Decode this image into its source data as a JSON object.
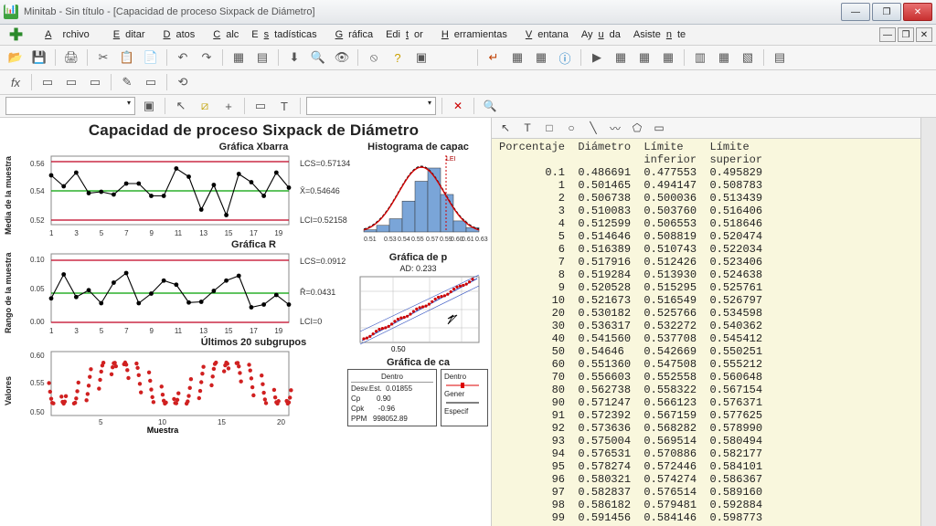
{
  "window": {
    "title": "Minitab - Sin título - [Capacidad de proceso Sixpack de Diámetro]"
  },
  "menu": [
    "Archivo",
    "Editar",
    "Datos",
    "Calc",
    "Estadísticas",
    "Gráfica",
    "Editor",
    "Herramientas",
    "Ventana",
    "Ayuda",
    "Asistente"
  ],
  "main": {
    "title": "Capacidad de proceso Sixpack de Diámetro",
    "xbar_title": "Gráfica Xbarra",
    "xbar_ylabel": "Media de la muestra",
    "xbar_lcs": "LCS=0.57134",
    "xbar_mean": "X̄=0.54646",
    "xbar_lci": "LCI=0.52158",
    "r_title": "Gráfica R",
    "r_ylabel": "Rango de la muestra",
    "r_lcs": "LCS=0.0912",
    "r_mean": "R̄=0.0431",
    "r_lci": "LCI=0",
    "sub_title": "Últimos 20 subgrupos",
    "sub_ylabel": "Valores",
    "sub_xlabel": "Muestra",
    "hist_title": "Histograma de capac",
    "prob_title": "Gráfica de p",
    "prob_ad": "AD: 0.233",
    "cap_title": "Gráfica de ca",
    "legend": {
      "head": "Dentro",
      "desv": "Desv.Est.",
      "desv_v": "0.01855",
      "cp": "Cp",
      "cp_v": "0.90",
      "cpk": "Cpk",
      "cpk_v": "-0.96",
      "ppm": "PPM",
      "ppm_v": "998052.89",
      "gen": "Gener",
      "esp": "Especif"
    }
  },
  "chart_data": [
    {
      "type": "line",
      "name": "xbar",
      "x": [
        1,
        3,
        5,
        7,
        9,
        11,
        13,
        15,
        17,
        19
      ],
      "values": [
        0.556,
        0.548,
        0.558,
        0.543,
        0.544,
        0.542,
        0.55,
        0.55,
        0.541,
        0.541,
        0.561,
        0.555,
        0.531,
        0.549,
        0.527,
        0.557,
        0.551,
        0.541,
        0.558,
        0.547
      ],
      "center": 0.54646,
      "ucl": 0.57134,
      "lcl": 0.52158,
      "ylim": [
        0.52,
        0.57
      ]
    },
    {
      "type": "line",
      "name": "r",
      "x": [
        1,
        3,
        5,
        7,
        9,
        11,
        13,
        15,
        17,
        19
      ],
      "values": [
        0.035,
        0.07,
        0.037,
        0.047,
        0.028,
        0.058,
        0.072,
        0.028,
        0.042,
        0.061,
        0.055,
        0.029,
        0.03,
        0.046,
        0.061,
        0.068,
        0.022,
        0.026,
        0.04,
        0.026
      ],
      "center": 0.0431,
      "ucl": 0.0912,
      "lcl": 0,
      "ylim": [
        0.0,
        0.1
      ]
    },
    {
      "type": "scatter",
      "name": "last20",
      "xlabel": "Muestra",
      "x": [
        1,
        2,
        3,
        4,
        5,
        6,
        7,
        8,
        9,
        10,
        11,
        12,
        13,
        14,
        15,
        16,
        17,
        18,
        19,
        20
      ],
      "ylim": [
        0.5,
        0.6
      ]
    },
    {
      "type": "bar",
      "name": "histogram",
      "categories": [
        0.51,
        0.53,
        0.54,
        0.55,
        0.57,
        0.59,
        0.6,
        0.61,
        0.63
      ],
      "values": [
        1,
        3,
        6,
        14,
        23,
        29,
        17,
        5,
        2
      ]
    },
    {
      "type": "line",
      "name": "probability",
      "xticks": [
        0.5
      ]
    }
  ],
  "table": {
    "headers": [
      "Porcentaje",
      "Diámetro",
      "Límite inferior",
      "Límite superior"
    ],
    "rows": [
      [
        "0.1",
        "0.486691",
        "0.477553",
        "0.495829"
      ],
      [
        "1",
        "0.501465",
        "0.494147",
        "0.508783"
      ],
      [
        "2",
        "0.506738",
        "0.500036",
        "0.513439"
      ],
      [
        "3",
        "0.510083",
        "0.503760",
        "0.516406"
      ],
      [
        "4",
        "0.512599",
        "0.506553",
        "0.518646"
      ],
      [
        "5",
        "0.514646",
        "0.508819",
        "0.520474"
      ],
      [
        "6",
        "0.516389",
        "0.510743",
        "0.522034"
      ],
      [
        "7",
        "0.517916",
        "0.512426",
        "0.523406"
      ],
      [
        "8",
        "0.519284",
        "0.513930",
        "0.524638"
      ],
      [
        "9",
        "0.520528",
        "0.515295",
        "0.525761"
      ],
      [
        "10",
        "0.521673",
        "0.516549",
        "0.526797"
      ],
      [
        "20",
        "0.530182",
        "0.525766",
        "0.534598"
      ],
      [
        "30",
        "0.536317",
        "0.532272",
        "0.540362"
      ],
      [
        "40",
        "0.541560",
        "0.537708",
        "0.545412"
      ],
      [
        "50",
        "0.54646",
        "0.542669",
        "0.550251"
      ],
      [
        "60",
        "0.551360",
        "0.547508",
        "0.555212"
      ],
      [
        "70",
        "0.556603",
        "0.552558",
        "0.560648"
      ],
      [
        "80",
        "0.562738",
        "0.558322",
        "0.567154"
      ],
      [
        "90",
        "0.571247",
        "0.566123",
        "0.576371"
      ],
      [
        "91",
        "0.572392",
        "0.567159",
        "0.577625"
      ],
      [
        "92",
        "0.573636",
        "0.568282",
        "0.578990"
      ],
      [
        "93",
        "0.575004",
        "0.569514",
        "0.580494"
      ],
      [
        "94",
        "0.576531",
        "0.570886",
        "0.582177"
      ],
      [
        "95",
        "0.578274",
        "0.572446",
        "0.584101"
      ],
      [
        "96",
        "0.580321",
        "0.574274",
        "0.586367"
      ],
      [
        "97",
        "0.582837",
        "0.576514",
        "0.589160"
      ],
      [
        "98",
        "0.586182",
        "0.579481",
        "0.592884"
      ],
      [
        "99",
        "0.591456",
        "0.584146",
        "0.598773"
      ]
    ]
  }
}
